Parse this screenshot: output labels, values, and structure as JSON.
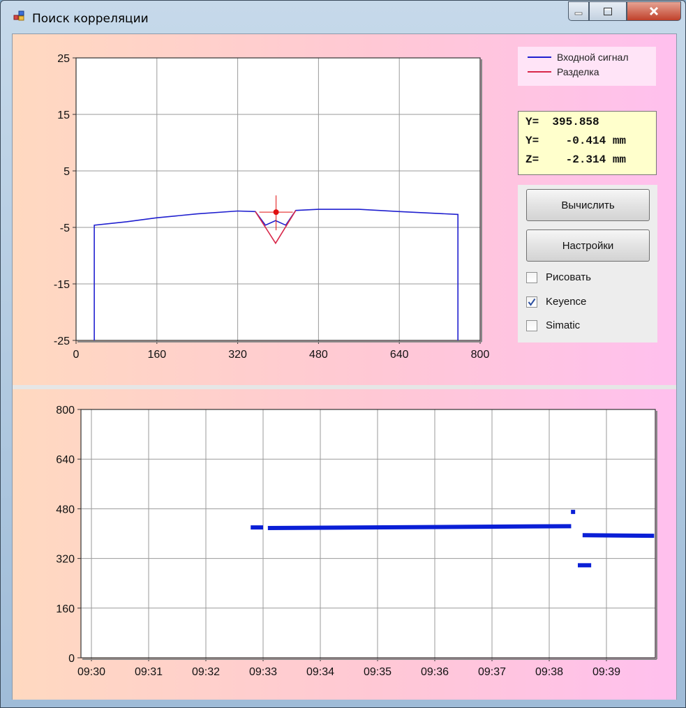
{
  "window": {
    "title": "Поиск корреляции",
    "icon": "app-window-icon"
  },
  "legend": {
    "items": [
      {
        "label": "Входной сигнал",
        "color": "#1f1fcf"
      },
      {
        "label": "Разделка",
        "color": "#d8284a"
      }
    ]
  },
  "readout": {
    "lines": [
      "Y=  395.858",
      "Y=    -0.414 mm",
      "Z=    -2.314 mm"
    ]
  },
  "controls": {
    "calculate_label": "Вычислить",
    "settings_label": "Настройки",
    "checkboxes": [
      {
        "label": "Рисовать",
        "checked": false
      },
      {
        "label": "Keyence",
        "checked": true
      },
      {
        "label": "Simatic",
        "checked": false
      }
    ]
  },
  "chart_data": [
    {
      "type": "line",
      "title": "",
      "xlim": [
        0,
        800
      ],
      "ylim": [
        -25,
        25
      ],
      "x_ticks": [
        0,
        160,
        320,
        480,
        640,
        800
      ],
      "y_ticks": [
        25,
        15,
        5,
        -5,
        -15,
        -25
      ],
      "grid": true,
      "legend_position": "top-right",
      "series": [
        {
          "name": "Входной сигнал",
          "color": "#1f1fcf",
          "points": [
            [
              36,
              -25
            ],
            [
              36,
              -4.6
            ],
            [
              100,
              -4.0
            ],
            [
              160,
              -3.3
            ],
            [
              240,
              -2.6
            ],
            [
              320,
              -2.1
            ],
            [
              355,
              -2.2
            ],
            [
              375,
              -4.6
            ],
            [
              395,
              -3.8
            ],
            [
              415,
              -4.6
            ],
            [
              435,
              -2.0
            ],
            [
              480,
              -1.8
            ],
            [
              560,
              -1.8
            ],
            [
              640,
              -2.2
            ],
            [
              756,
              -2.7
            ],
            [
              756,
              -25
            ]
          ]
        },
        {
          "name": "Разделка",
          "color": "#d8284a",
          "points": [
            [
              355,
              -2.2
            ],
            [
              395,
              -7.8
            ],
            [
              435,
              -2.0
            ]
          ]
        }
      ],
      "marker": {
        "x": 396,
        "y": -2.3,
        "color": "#e01010"
      }
    },
    {
      "type": "scatter",
      "title": "",
      "ylim": [
        0,
        800
      ],
      "y_ticks": [
        800,
        640,
        480,
        320,
        160,
        0
      ],
      "x_tick_labels": [
        "09:30",
        "09:31",
        "09:32",
        "09:33",
        "09:34",
        "09:35",
        "09:36",
        "09:37",
        "09:38",
        "09:39"
      ],
      "grid": true,
      "color": "#0a1fd6",
      "segments": [
        {
          "x0": "09:32:47",
          "x1": "09:33:00",
          "y0": 420,
          "y1": 420
        },
        {
          "x0": "09:33:05",
          "x1": "09:38:23",
          "y0": 418,
          "y1": 424
        },
        {
          "x0": "09:38:30",
          "x1": "09:38:44",
          "y0": 298,
          "y1": 298
        },
        {
          "x0": "09:38:35",
          "x1": "09:39:50",
          "y0": 395,
          "y1": 393
        }
      ],
      "points": [
        {
          "x": "09:38:25",
          "y": 470
        }
      ]
    }
  ]
}
